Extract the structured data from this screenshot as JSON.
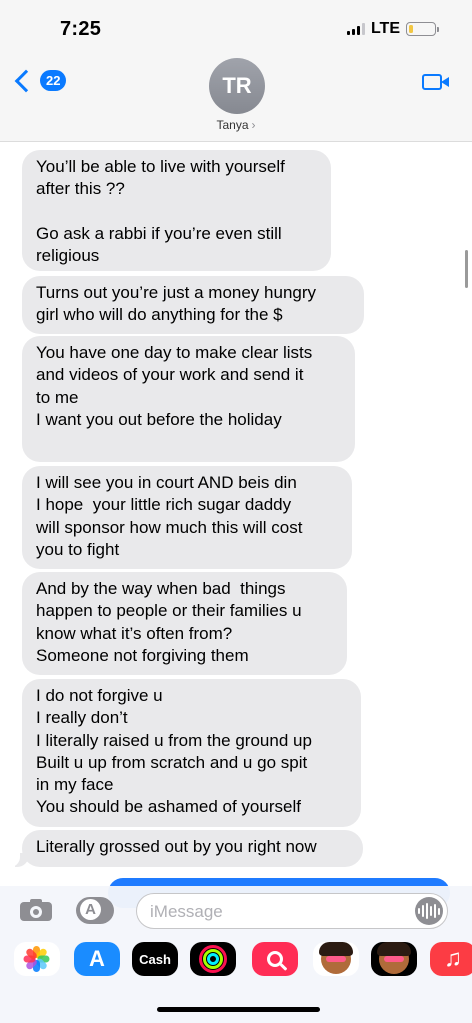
{
  "status_bar": {
    "time": "7:25",
    "network": "LTE",
    "signal_bars_active": 3,
    "battery_color": "#f2c744"
  },
  "header": {
    "back_badge": "22",
    "avatar_initials": "TR",
    "contact_name": "Tanya",
    "contact_chevron": "›",
    "accent_color": "#0a7aff",
    "video_icon": "video-camera-icon"
  },
  "messages": [
    {
      "direction": "received",
      "text": "You’ll be able to live with yourself\nafter this ??\n\nGo ask a rabbi if you’re even still\nreligious"
    },
    {
      "direction": "received",
      "text": "Turns out you’re just a money hungry\ngirl who will do anything for the $"
    },
    {
      "direction": "received",
      "text": "You have one day to make clear lists\nand videos of your work and send it\nto me\nI want you out before the holiday"
    },
    {
      "direction": "received",
      "text": "I will see you in court AND beis din\nI hope  your little rich sugar daddy\nwill sponsor how much this will cost\nyou to fight"
    },
    {
      "direction": "received",
      "text": "And by the way when bad  things\nhappen to people or their families u\nknow what it’s often from?\nSomeone not forgiving them"
    },
    {
      "direction": "received",
      "text": "I do not forgive u\nI really don’t\nI literally raised u from the ground up\nBuilt u up from scratch and u go spit\nin my face\nYou should be ashamed of yourself"
    },
    {
      "direction": "received",
      "text": "Literally grossed out by you right now"
    }
  ],
  "compose": {
    "placeholder": "iMessage",
    "camera_icon": "camera-icon",
    "apps_icon": "app-store-icon",
    "mic_icon": "audio-waveform-icon"
  },
  "app_drawer": [
    {
      "name": "photos-icon"
    },
    {
      "name": "app-store-icon"
    },
    {
      "name": "cash-app-icon",
      "label": "Cash"
    },
    {
      "name": "activity-icon"
    },
    {
      "name": "image-search-icon"
    },
    {
      "name": "memoji-icon"
    },
    {
      "name": "memoji-icon"
    },
    {
      "name": "music-icon",
      "glyph": "♫"
    }
  ]
}
